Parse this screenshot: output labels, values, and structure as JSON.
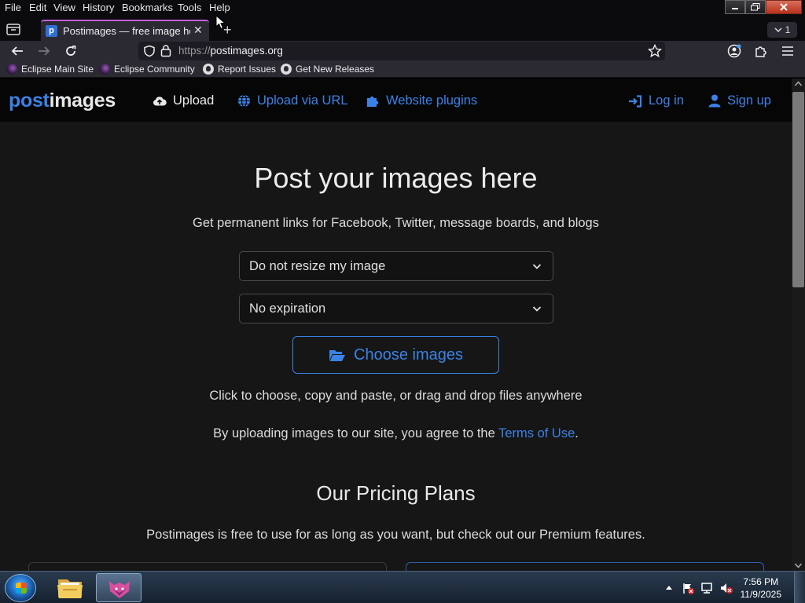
{
  "menubar": {
    "items": [
      {
        "label": "File",
        "key": "F"
      },
      {
        "label": "Edit",
        "key": "E"
      },
      {
        "label": "View",
        "key": "V"
      },
      {
        "label": "History",
        "key": "s"
      },
      {
        "label": "Bookmarks",
        "key": "B"
      },
      {
        "label": "Tools",
        "key": "T"
      },
      {
        "label": "Help",
        "key": "H"
      }
    ]
  },
  "tabs": {
    "active_title": "Postimages — free image hosting",
    "favicon_letter": "p",
    "count": "1"
  },
  "navbar": {
    "url_protocol": "https://",
    "url_host": "postimages.org"
  },
  "bookmarks": [
    {
      "label": "Eclipse Main Site",
      "icon": "eclipse-icon"
    },
    {
      "label": "Eclipse Community",
      "icon": "eclipse-icon"
    },
    {
      "label": "Report Issues",
      "icon": "github-icon"
    },
    {
      "label": "Get New Releases",
      "icon": "github-icon"
    }
  ],
  "site": {
    "logo_post": "post",
    "logo_images": "images",
    "nav": {
      "upload": "Upload",
      "upload_url": "Upload via URL",
      "plugins": "Website plugins",
      "login": "Log in",
      "signup": "Sign up"
    },
    "hero_title": "Post your images here",
    "hero_subtitle": "Get permanent links for Facebook, Twitter, message boards, and blogs",
    "resize_select": "Do not resize my image",
    "expiration_select": "No expiration",
    "choose_button": "Choose images",
    "hint": "Click to choose, copy and paste, or drag and drop files anywhere",
    "agree_prefix": "By uploading images to our site, you agree to the ",
    "agree_link": "Terms of Use",
    "agree_suffix": ".",
    "pricing_title": "Our Pricing Plans",
    "pricing_subtitle": "Postimages is free to use for as long as you want, but check out our Premium features."
  },
  "taskbar": {
    "time": "7:56 PM",
    "date": "11/9/2025"
  },
  "colors": {
    "accent_blue": "#3b82e6",
    "page_bg": "#161616",
    "header_bg": "#060606",
    "tab_highlight": "#c060d8"
  }
}
